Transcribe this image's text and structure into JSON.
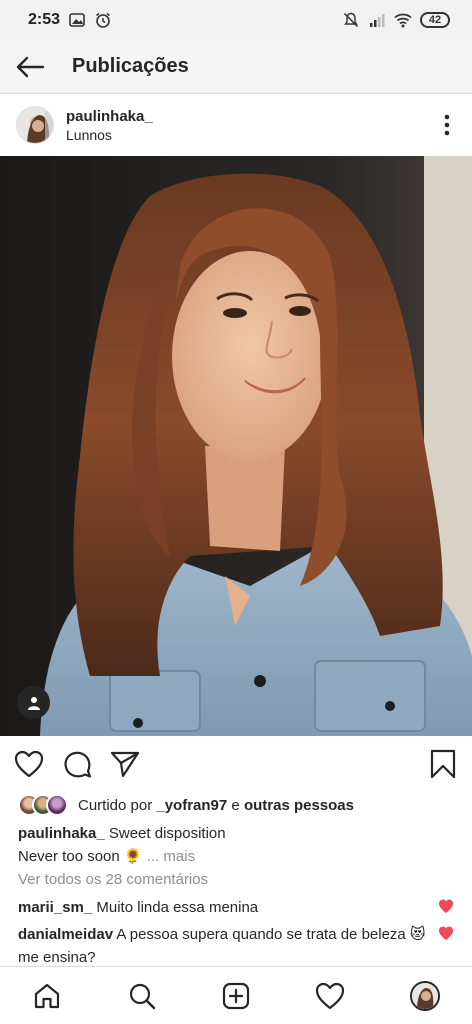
{
  "status": {
    "time": "2:53",
    "battery": "42"
  },
  "header": {
    "title": "Publicações"
  },
  "post": {
    "username": "paulinhaka_",
    "location": "Lunnos",
    "liked_by_prefix": "Curtido por ",
    "liked_by_user": "_yofran97",
    "liked_by_join": " e ",
    "liked_by_others": "outras pessoas",
    "caption_user": "paulinhaka_",
    "caption_line1": " Sweet disposition",
    "caption_line2": "Never too soon 🌻",
    "caption_more": "... mais",
    "view_comments": "Ver todos os 28 comentários",
    "comments": [
      {
        "user": "marii_sm_",
        "text": " Muito linda essa menina"
      },
      {
        "user": "danialmeidav",
        "text": " A pessoa supera quando se trata de beleza 😻 me ensina?"
      }
    ]
  },
  "colors": {
    "accent_heart": "#ed4956",
    "text": "#262626",
    "muted": "#8e8e8e"
  },
  "icons": {
    "back": "arrow-left-icon",
    "more": "more-vertical-icon",
    "tag": "person-tag-icon",
    "like": "heart-icon",
    "comment": "comment-icon",
    "share": "send-icon",
    "save": "bookmark-icon",
    "home": "home-icon",
    "search": "search-icon",
    "add": "add-post-icon",
    "activity": "heart-icon"
  }
}
